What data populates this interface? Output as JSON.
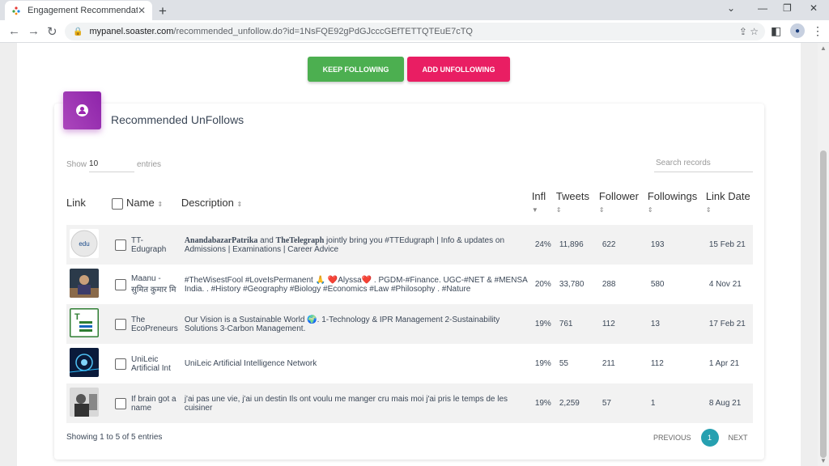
{
  "browser": {
    "tab_title": "Engagement Recommendations",
    "url_host": "mypanel.soaster.com",
    "url_path": "/recommended_unfollow.do?id=1NsFQE92gPdGJcccGEfTETTQTEuE7cTQ"
  },
  "actions": {
    "keep_label": "KEEP FOLLOWING",
    "add_label": "ADD UNFOLLOWING"
  },
  "card": {
    "title": "Recommended UnFollows"
  },
  "controls": {
    "show_label": "Show",
    "show_value": "10",
    "entries_label": "entries",
    "search_placeholder": "Search records"
  },
  "table": {
    "headers": {
      "link": "Link",
      "name": "Name",
      "description": "Description",
      "infl": "Infl",
      "tweets": "Tweets",
      "follower": "Follower",
      "followings": "Followings",
      "link_date": "Link Date"
    },
    "rows": [
      {
        "name": "TT-Edugraph",
        "desc_bold1": "AnandabazarPatrika",
        "desc_mid": " and ",
        "desc_bold2": "TheTelegraph",
        "desc_rest": " jointly bring you #TTEdugraph | Info & updates on Admissions | Examinations | Career Advice",
        "infl": "24%",
        "tweets": "11,896",
        "follower": "622",
        "followings": "193",
        "date": "15 Feb 21"
      },
      {
        "name": "Maanu - सुमित कुमार मि",
        "description": "#TheWisestFool #LoveIsPermanent 🙏 ❤️Alyssa❤️ . PGDM-#Finance. UGC-#NET & #MENSA India. . #History #Geography #Biology #Economics #Law #Philosophy . #Nature",
        "infl": "20%",
        "tweets": "33,780",
        "follower": "288",
        "followings": "580",
        "date": "4 Nov 21"
      },
      {
        "name": "The EcoPreneurs",
        "description": "Our Vision is a Sustainable World 🌍. 1-Technology & IPR Management 2-Sustainability Solutions 3-Carbon Management.",
        "infl": "19%",
        "tweets": "761",
        "follower": "112",
        "followings": "13",
        "date": "17 Feb 21"
      },
      {
        "name": "UniLeic Artificial Int",
        "description": "UniLeic Artificial Intelligence Network",
        "infl": "19%",
        "tweets": "55",
        "follower": "211",
        "followings": "112",
        "date": "1 Apr 21"
      },
      {
        "name": "If brain got a name",
        "description": "j'ai pas une vie, j'ai un destin Ils ont voulu me manger cru mais moi j'ai pris le temps de les cuisiner",
        "infl": "19%",
        "tweets": "2,259",
        "follower": "57",
        "followings": "1",
        "date": "8 Aug 21"
      }
    ]
  },
  "footer": {
    "info": "Showing 1 to 5 of 5 entries",
    "previous": "PREVIOUS",
    "page": "1",
    "next": "NEXT"
  },
  "colors": {
    "keep_button": "#4caf50",
    "add_button": "#e91e63",
    "card_icon": "#9c27b0",
    "active_page": "#26a0b0"
  }
}
